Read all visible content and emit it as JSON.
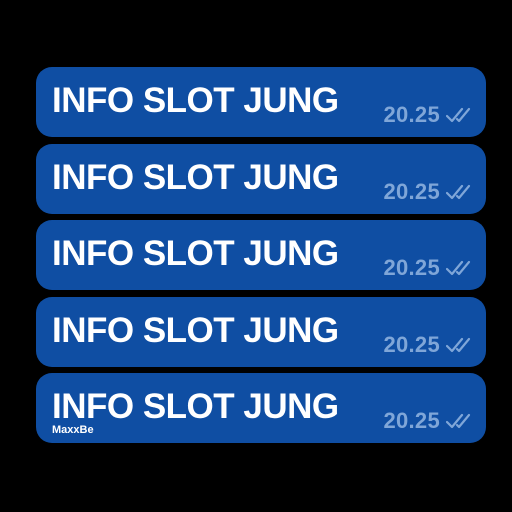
{
  "colors": {
    "background": "#000000",
    "bubble": "#0f4ea3",
    "text": "#ffffff",
    "meta": "#7fa6d8"
  },
  "messages": [
    {
      "text": "INFO SLOT JUNG",
      "time": "20.25",
      "status_icon": "double-check-icon"
    },
    {
      "text": "INFO SLOT JUNG",
      "time": "20.25",
      "status_icon": "double-check-icon"
    },
    {
      "text": "INFO SLOT JUNG",
      "time": "20.25",
      "status_icon": "double-check-icon"
    },
    {
      "text": "INFO SLOT JUNG",
      "time": "20.25",
      "status_icon": "double-check-icon"
    },
    {
      "text": "INFO SLOT JUNG",
      "time": "20.25",
      "status_icon": "double-check-icon",
      "watermark": "MaxxBe"
    }
  ]
}
